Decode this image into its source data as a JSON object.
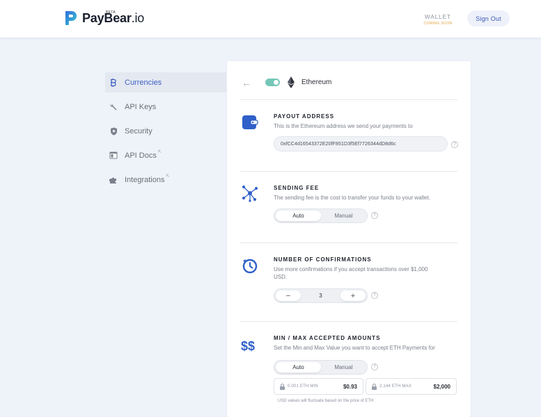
{
  "header": {
    "brand": "PayBear",
    "brand_suffix": ".io",
    "beta": "BETA",
    "wallet_label": "WALLET",
    "wallet_sub": "COMING SOON",
    "signout_label": "Sign Out"
  },
  "sidebar": {
    "items": [
      {
        "label": "Currencies",
        "icon": "bitcoin-icon"
      },
      {
        "label": "API Keys",
        "icon": "wrench-icon"
      },
      {
        "label": "Security",
        "icon": "shield-icon"
      },
      {
        "label": "API Docs",
        "icon": "browser-icon",
        "external": "⇱"
      },
      {
        "label": "Integrations",
        "icon": "puzzle-icon",
        "external": "⇱"
      }
    ]
  },
  "currency": {
    "name": "Ethereum",
    "enabled": true,
    "back_icon": "←"
  },
  "payout": {
    "title": "PAYOUT ADDRESS",
    "desc": "This is the Ethereum address we send your payments to",
    "address": "0xfCC4d16543372E20fF851D3f5Ef7726344dD8d6c",
    "help": "?"
  },
  "fee": {
    "title": "SENDING FEE",
    "desc": "The sending fee is the cost to transfer your funds to your wallet.",
    "options": [
      "Auto",
      "Manual"
    ],
    "selected": "Auto",
    "help": "?"
  },
  "confirmations": {
    "title": "NUMBER OF CONFIRMATIONS",
    "desc": "Use more confirmations if you accept transactions over $1,000 USD.",
    "minus": "−",
    "plus": "+",
    "value": "3",
    "help": "?"
  },
  "amounts": {
    "title": "MIN / MAX ACCEPTED AMOUNTS",
    "desc": "Set the Min and Max Value you want to accept ETH Payments for",
    "options": [
      "Auto",
      "Manual"
    ],
    "selected": "Auto",
    "help": "?",
    "min_label": "0.001 ETH MIN",
    "min_value": "$0.93",
    "max_label": "2.144 ETH MAX",
    "max_value": "$2,000",
    "note": "USD values will fluctuate based on the price of ETH"
  },
  "colors": {
    "accent": "#3d62c4",
    "toggle": "#76c7b7",
    "wallet_sub": "#e0a23c"
  }
}
